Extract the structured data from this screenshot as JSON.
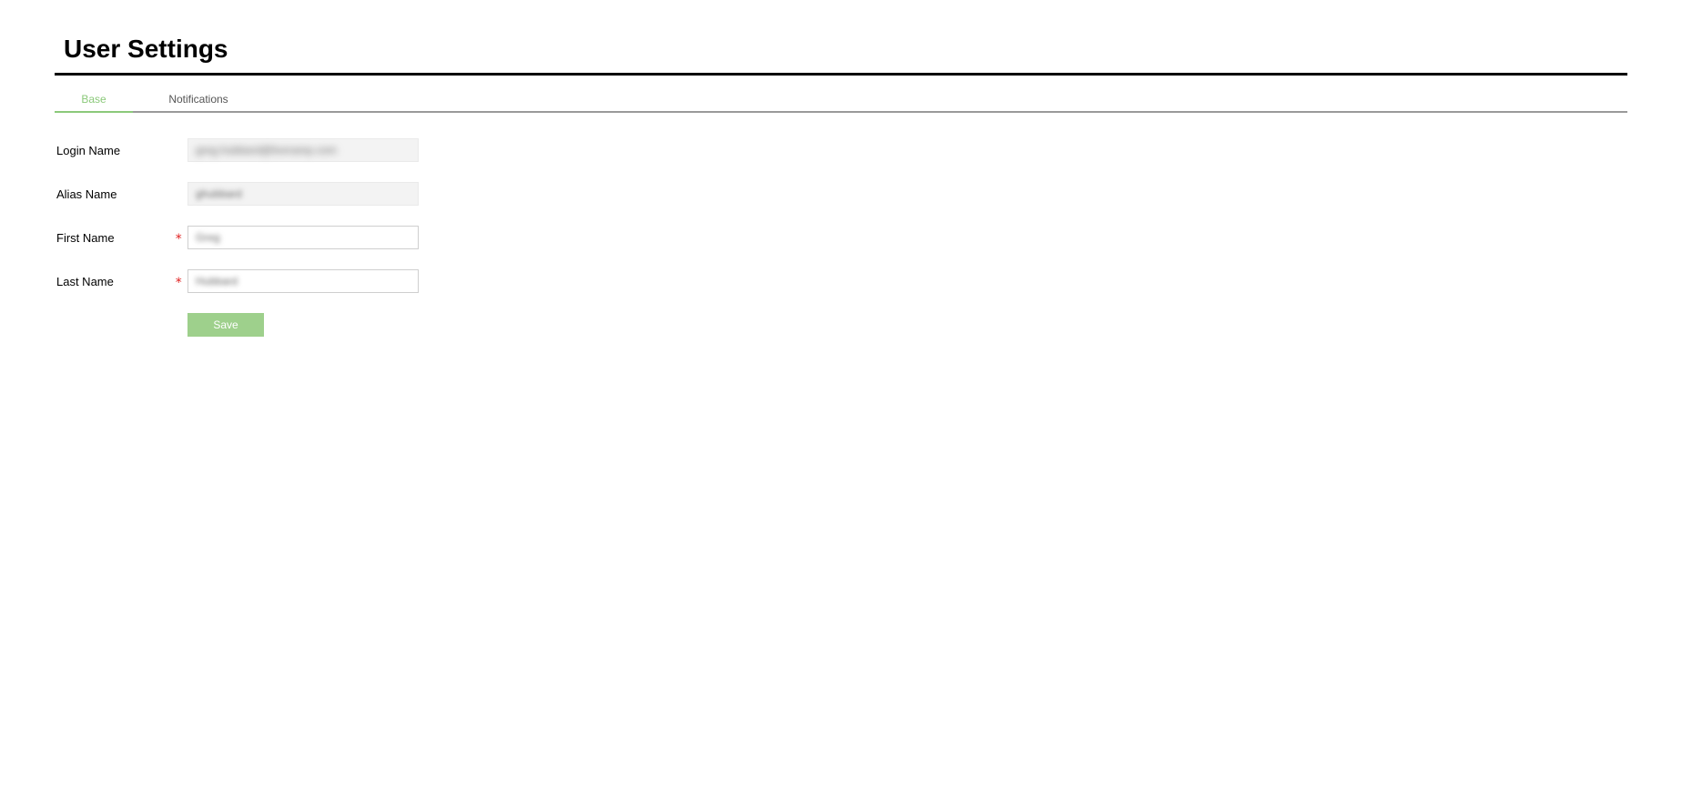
{
  "header": {
    "title": "User Settings"
  },
  "tabs": {
    "base": "Base",
    "notifications": "Notifications"
  },
  "form": {
    "login_name_label": "Login Name",
    "login_name_value": "greg.hubbard@liveramp.com",
    "alias_name_label": "Alias Name",
    "alias_name_value": "ghubbard",
    "first_name_label": "First Name",
    "first_name_value": "Greg",
    "last_name_label": "Last Name",
    "last_name_value": "Hubbard",
    "required_marker": "*",
    "save_label": "Save"
  }
}
